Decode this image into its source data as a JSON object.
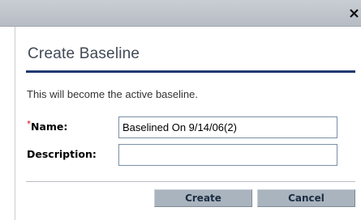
{
  "titlebar": {
    "close_glyph": "x",
    "close_icon": "close-icon"
  },
  "dialog": {
    "title": "Create Baseline",
    "info_text": "This will become the active baseline."
  },
  "form": {
    "name": {
      "required_marker": "*",
      "label": "Name:",
      "value": "Baselined On 9/14/06(2)"
    },
    "description": {
      "label": "Description:",
      "value": ""
    }
  },
  "buttons": {
    "create_label": "Create",
    "cancel_label": "Cancel"
  },
  "colors": {
    "accent_rule": "#1f3a6e",
    "required": "#cc0000",
    "button_bg": "#a9b4be",
    "titlebar_bg": "#c0c4cb"
  }
}
